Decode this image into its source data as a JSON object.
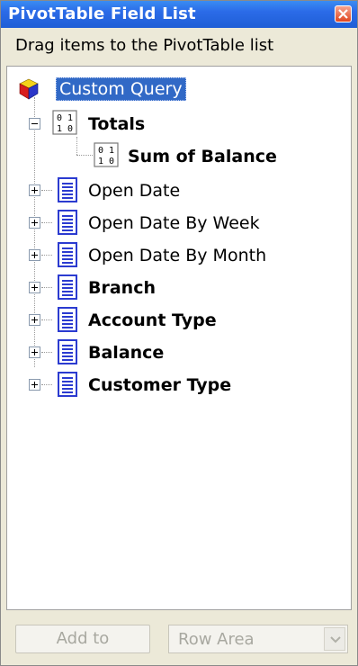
{
  "window": {
    "title": "PivotTable Field List"
  },
  "instruction": "Drag items to the PivotTable list",
  "tree": {
    "root_label": "Custom Query",
    "totals": {
      "label": "Totals",
      "child": "Sum of Balance"
    },
    "fields": [
      "Open Date",
      "Open Date By Week",
      "Open Date By Month",
      "Branch",
      "Account Type",
      "Balance",
      "Customer Type"
    ]
  },
  "footer": {
    "add_to_label": "Add to",
    "area_value": "Row Area"
  },
  "colors": {
    "title_bar": "#2b6be8",
    "selection": "#3169c6",
    "field_icon": "#2b3bd0"
  }
}
